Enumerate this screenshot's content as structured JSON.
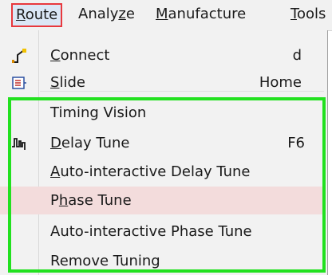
{
  "menubar": {
    "route": {
      "mnemonic": "R",
      "rest": "oute"
    },
    "analyze": {
      "pre": "Analy",
      "mnemonic": "z",
      "rest": "e"
    },
    "manufacture": {
      "mnemonic": "M",
      "rest": "anufacture"
    },
    "tools": {
      "mnemonic": "T",
      "rest": "ools"
    }
  },
  "menu": {
    "connect": {
      "mnemonic": "C",
      "rest": "onnect",
      "shortcut": "d",
      "icon": "connect-icon"
    },
    "slide": {
      "mnemonic": "S",
      "rest": "lide",
      "shortcut": "Home",
      "icon": "slide-icon"
    },
    "timing_vision": {
      "label": "Timing Vision"
    },
    "delay_tune": {
      "mnemonic": "D",
      "rest": "elay Tune",
      "shortcut": "F6",
      "icon": "delay-tune-icon"
    },
    "auto_delay_tune": {
      "mnemonic": "A",
      "rest": "uto-interactive Delay Tune"
    },
    "phase_tune": {
      "pre": "P",
      "mnemonic": "h",
      "rest": "ase Tune"
    },
    "auto_phase_tune": {
      "label": "Auto-interactive Phase Tune"
    },
    "remove_tuning": {
      "label": "Remove Tuning"
    }
  },
  "colors": {
    "highlight_box": "#22e11f",
    "active_border": "#e8383d",
    "hover_bg": "#f3dcdc"
  }
}
